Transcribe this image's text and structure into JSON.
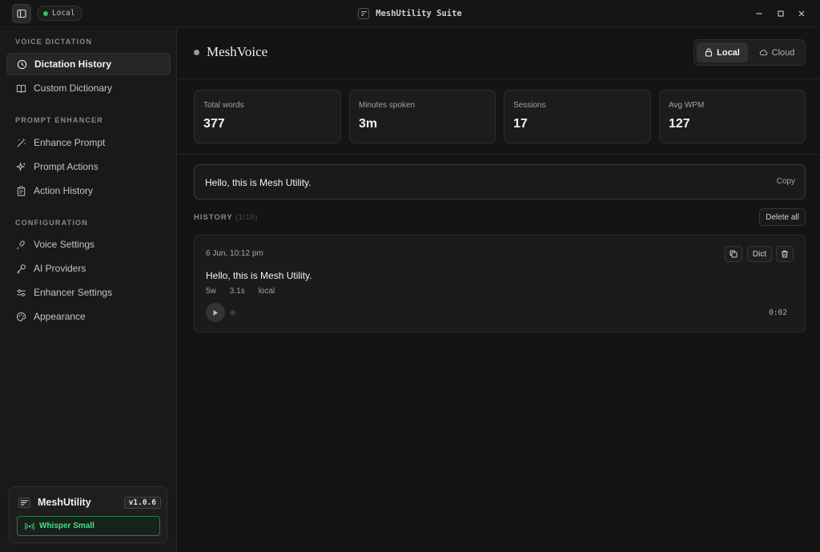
{
  "titlebar": {
    "mode_pill": "Local",
    "app_title": "MeshUtility Suite"
  },
  "sidebar": {
    "sections": [
      {
        "label": "VOICE DICTATION",
        "items": [
          {
            "label": "Dictation History",
            "icon": "clock-icon",
            "active": true
          },
          {
            "label": "Custom Dictionary",
            "icon": "book-icon",
            "active": false
          }
        ]
      },
      {
        "label": "PROMPT ENHANCER",
        "items": [
          {
            "label": "Enhance Prompt",
            "icon": "magic-wand-icon",
            "active": false
          },
          {
            "label": "Prompt Actions",
            "icon": "sparkles-icon",
            "active": false
          },
          {
            "label": "Action History",
            "icon": "clipboard-icon",
            "active": false
          }
        ]
      },
      {
        "label": "CONFIGURATION",
        "items": [
          {
            "label": "Voice Settings",
            "icon": "microphone-icon",
            "active": false
          },
          {
            "label": "AI Providers",
            "icon": "key-icon",
            "active": false
          },
          {
            "label": "Enhancer Settings",
            "icon": "sliders-icon",
            "active": false
          },
          {
            "label": "Appearance",
            "icon": "palette-icon",
            "active": false
          }
        ]
      }
    ],
    "brand": {
      "name": "MeshUtility",
      "version": "v1.0.6",
      "model_label": "Whisper Small"
    }
  },
  "main": {
    "title": "MeshVoice",
    "mode_toggle": {
      "options": [
        "Local",
        "Cloud"
      ],
      "selected": "Local"
    },
    "stats": [
      {
        "label": "Total words",
        "value": "377"
      },
      {
        "label": "Minutes spoken",
        "value": "3m"
      },
      {
        "label": "Sessions",
        "value": "17"
      },
      {
        "label": "Avg WPM",
        "value": "127"
      }
    ],
    "transcript": {
      "text": "Hello, this is Mesh Utility.",
      "copy_label": "Copy"
    },
    "history": {
      "label": "HISTORY",
      "count": "(1/10)",
      "delete_all_label": "Delete all",
      "entries": [
        {
          "timestamp": "6 Jun, 10:12 pm",
          "text": "Hello, this is Mesh Utility.",
          "words": "5w",
          "length": "3.1s",
          "source": "local",
          "duration": "0:02",
          "dict_label": "Dict"
        }
      ]
    }
  },
  "colors": {
    "accent_green": "#22c55e",
    "background": "#141414",
    "sidebar": "#191919"
  }
}
